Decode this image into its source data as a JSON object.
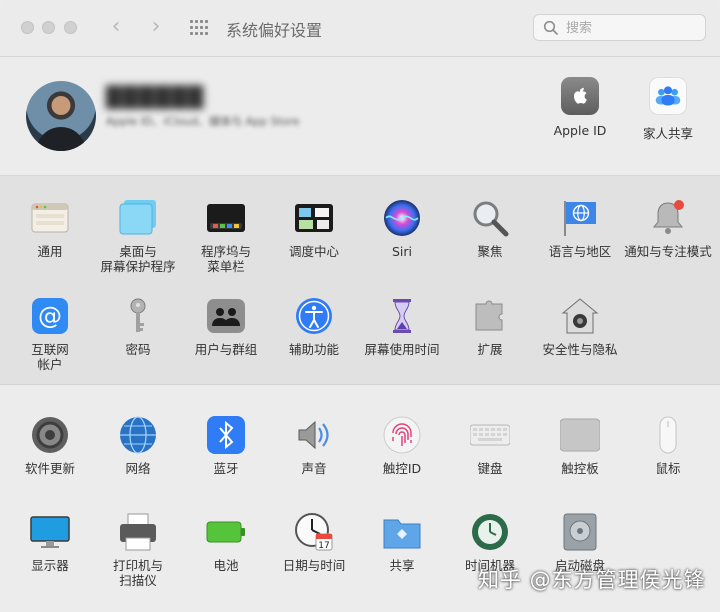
{
  "window": {
    "title": "系统偏好设置",
    "search": {
      "placeholder": "搜索",
      "value": ""
    }
  },
  "account": {
    "user_name": "██████",
    "user_subtitle": "Apple ID、iCloud、媒体与 App Store",
    "items": [
      {
        "label": "Apple ID",
        "icon": "apple-logo-icon"
      },
      {
        "label": "家人共享",
        "icon": "family-sharing-icon"
      }
    ]
  },
  "panes_primary": [
    {
      "label": "通用",
      "icon": "general-icon"
    },
    {
      "label": "桌面与\n屏幕保护程序",
      "icon": "desktop-screensaver-icon"
    },
    {
      "label": "程序坞与\n菜单栏",
      "icon": "dock-menubar-icon"
    },
    {
      "label": "调度中心",
      "icon": "mission-control-icon"
    },
    {
      "label": "Siri",
      "icon": "siri-icon"
    },
    {
      "label": "聚焦",
      "icon": "spotlight-icon"
    },
    {
      "label": "语言与地区",
      "icon": "language-region-icon"
    },
    {
      "label": "通知与专注模式",
      "icon": "notifications-icon"
    },
    {
      "label": "互联网\n帐户",
      "icon": "internet-accounts-icon"
    },
    {
      "label": "密码",
      "icon": "passwords-icon"
    },
    {
      "label": "用户与群组",
      "icon": "users-groups-icon"
    },
    {
      "label": "辅助功能",
      "icon": "accessibility-icon"
    },
    {
      "label": "屏幕使用时间",
      "icon": "screen-time-icon"
    },
    {
      "label": "扩展",
      "icon": "extensions-icon"
    },
    {
      "label": "安全性与隐私",
      "icon": "security-privacy-icon"
    }
  ],
  "panes_hardware": [
    {
      "label": "软件更新",
      "icon": "software-update-icon"
    },
    {
      "label": "网络",
      "icon": "network-icon"
    },
    {
      "label": "蓝牙",
      "icon": "bluetooth-icon"
    },
    {
      "label": "声音",
      "icon": "sound-icon"
    },
    {
      "label": "触控ID",
      "icon": "touch-id-icon"
    },
    {
      "label": "键盘",
      "icon": "keyboard-icon"
    },
    {
      "label": "触控板",
      "icon": "trackpad-icon"
    },
    {
      "label": "鼠标",
      "icon": "mouse-icon"
    },
    {
      "label": "显示器",
      "icon": "displays-icon"
    },
    {
      "label": "打印机与\n扫描仪",
      "icon": "printers-scanners-icon"
    },
    {
      "label": "电池",
      "icon": "battery-icon"
    },
    {
      "label": "日期与时间",
      "icon": "date-time-icon"
    },
    {
      "label": "共享",
      "icon": "sharing-icon"
    },
    {
      "label": "时间机器",
      "icon": "time-machine-icon"
    },
    {
      "label": "启动磁盘",
      "icon": "startup-disk-icon"
    }
  ],
  "calendar_day": "17",
  "watermark": "知乎 @东方管理侯光锋",
  "colors": {
    "accent": "#2f7cf6",
    "background": "#ececec",
    "section_alt": "#e1e1e1"
  }
}
